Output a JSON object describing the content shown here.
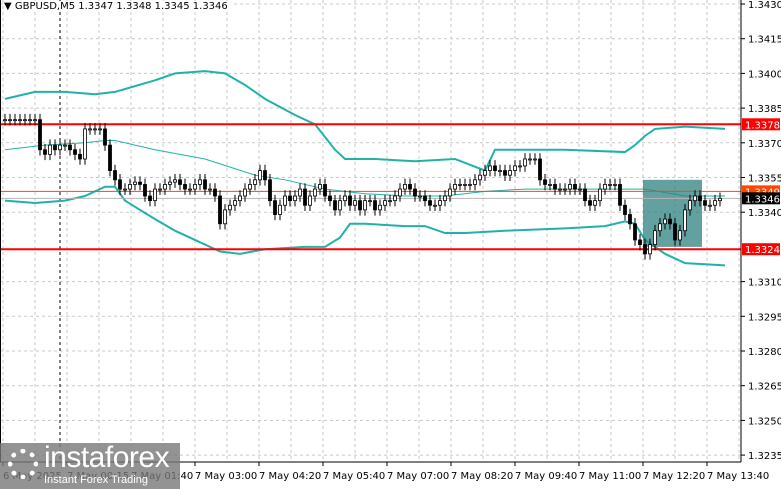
{
  "header": {
    "symbol": "GBPUSD,M5",
    "ohlc": "1.3347 1.3348 1.3345 1.3346"
  },
  "logo": {
    "brand": "instaforex",
    "tagline": "Instant Forex Trading"
  },
  "colors": {
    "band": "#20b2aa",
    "level": "#ff0000",
    "bid": "#ff4500",
    "highlight": "#2f8080"
  },
  "chart_data": {
    "type": "candlestick",
    "title": "GBPUSD,M5",
    "ylim": [
      1.3228,
      1.3432
    ],
    "yticks": [
      "1.3430",
      "1.3415",
      "1.3400",
      "1.3385",
      "1.3370",
      "1.3355",
      "1.3340",
      "1.3310",
      "1.3295",
      "1.3280",
      "1.3265",
      "1.3250",
      "1.3235"
    ],
    "xticks": [
      "6 May 2025",
      "7 May 00:15",
      "7 May 01:40",
      "7 May 03:00",
      "7 May 04:20",
      "7 May 05:40",
      "7 May 07:00",
      "7 May 08:20",
      "7 May 09:40",
      "7 May 11:00",
      "7 May 12:20",
      "7 May 13:40"
    ],
    "levels": [
      {
        "price": 1.3378,
        "label": "1.3378"
      },
      {
        "price": 1.3324,
        "label": "1.3324"
      }
    ],
    "ask_line": {
      "price": 1.3349,
      "label": "1.3349"
    },
    "bid_line": {
      "price": 1.3346,
      "label": "1.3346"
    },
    "highlight_zone": {
      "from_index": 128,
      "to_index": 139,
      "high": 1.3354,
      "low": 1.3325
    },
    "closes": [
      1.338,
      1.338,
      1.338,
      1.338,
      1.338,
      1.338,
      1.338,
      1.3367,
      1.3365,
      1.3369,
      1.3367,
      1.3369,
      1.3369,
      1.3367,
      1.3365,
      1.3363,
      1.3376,
      1.3376,
      1.3376,
      1.3376,
      1.3369,
      1.3358,
      1.3354,
      1.335,
      1.335,
      1.3352,
      1.3353,
      1.3352,
      1.3347,
      1.3345,
      1.335,
      1.335,
      1.3352,
      1.3353,
      1.3354,
      1.3352,
      1.335,
      1.335,
      1.3352,
      1.3354,
      1.335,
      1.335,
      1.3347,
      1.3335,
      1.3341,
      1.3343,
      1.3345,
      1.3347,
      1.335,
      1.3352,
      1.3354,
      1.3358,
      1.3354,
      1.3345,
      1.3339,
      1.3343,
      1.3347,
      1.3345,
      1.3347,
      1.335,
      1.3343,
      1.3347,
      1.335,
      1.3352,
      1.3347,
      1.3345,
      1.3341,
      1.3345,
      1.3347,
      1.3343,
      1.3345,
      1.3341,
      1.3345,
      1.3345,
      1.3341,
      1.3343,
      1.3345,
      1.3345,
      1.3347,
      1.335,
      1.3352,
      1.335,
      1.3347,
      1.3347,
      1.3345,
      1.3343,
      1.3343,
      1.3345,
      1.3347,
      1.335,
      1.3352,
      1.3352,
      1.3352,
      1.3352,
      1.3354,
      1.3356,
      1.3358,
      1.336,
      1.3358,
      1.3358,
      1.3356,
      1.3358,
      1.336,
      1.336,
      1.3363,
      1.3363,
      1.3363,
      1.3354,
      1.3352,
      1.3352,
      1.335,
      1.335,
      1.335,
      1.3352,
      1.335,
      1.335,
      1.3345,
      1.3343,
      1.3345,
      1.335,
      1.3352,
      1.3352,
      1.3352,
      1.3343,
      1.3339,
      1.3335,
      1.3328,
      1.3326,
      1.3322,
      1.3326,
      1.3332,
      1.3335,
      1.3337,
      1.3335,
      1.3328,
      1.3332,
      1.3341,
      1.3345,
      1.3347,
      1.3345,
      1.3343,
      1.3343,
      1.3345,
      1.3346
    ],
    "bands": {
      "upper": [
        [
          0,
          1.3389
        ],
        [
          6,
          1.3392
        ],
        [
          12,
          1.3392
        ],
        [
          18,
          1.3391
        ],
        [
          22,
          1.3392
        ],
        [
          30,
          1.3397
        ],
        [
          34,
          1.34
        ],
        [
          40,
          1.3401
        ],
        [
          44,
          1.34
        ],
        [
          48,
          1.3395
        ],
        [
          52,
          1.3389
        ],
        [
          58,
          1.3382
        ],
        [
          62,
          1.3378
        ],
        [
          66,
          1.3367
        ],
        [
          68,
          1.3363
        ],
        [
          74,
          1.3363
        ],
        [
          82,
          1.3362
        ],
        [
          90,
          1.3363
        ],
        [
          96,
          1.3358
        ],
        [
          98,
          1.3367
        ],
        [
          112,
          1.3367
        ],
        [
          124,
          1.3366
        ],
        [
          126,
          1.3369
        ],
        [
          128,
          1.3373
        ],
        [
          130,
          1.3376
        ],
        [
          136,
          1.3377
        ],
        [
          144,
          1.3376
        ]
      ],
      "middle": [
        [
          0,
          1.3367
        ],
        [
          8,
          1.3369
        ],
        [
          16,
          1.337
        ],
        [
          20,
          1.3371
        ],
        [
          22,
          1.3371
        ],
        [
          30,
          1.3367
        ],
        [
          40,
          1.3363
        ],
        [
          50,
          1.3356
        ],
        [
          56,
          1.3354
        ],
        [
          64,
          1.335
        ],
        [
          72,
          1.3348
        ],
        [
          80,
          1.3347
        ],
        [
          88,
          1.3347
        ],
        [
          96,
          1.3349
        ],
        [
          104,
          1.335
        ],
        [
          112,
          1.335
        ],
        [
          120,
          1.335
        ],
        [
          128,
          1.335
        ],
        [
          136,
          1.3347
        ],
        [
          144,
          1.3347
        ]
      ],
      "lower": [
        [
          0,
          1.3345
        ],
        [
          6,
          1.3344
        ],
        [
          12,
          1.3345
        ],
        [
          16,
          1.3347
        ],
        [
          20,
          1.3351
        ],
        [
          22,
          1.3351
        ],
        [
          24,
          1.3345
        ],
        [
          30,
          1.3337
        ],
        [
          34,
          1.3332
        ],
        [
          40,
          1.3326
        ],
        [
          43,
          1.3323
        ],
        [
          47,
          1.3322
        ],
        [
          52,
          1.3324
        ],
        [
          60,
          1.3325
        ],
        [
          64,
          1.3325
        ],
        [
          67,
          1.3329
        ],
        [
          69,
          1.3335
        ],
        [
          72,
          1.3335
        ],
        [
          80,
          1.3334
        ],
        [
          84,
          1.3334
        ],
        [
          88,
          1.3331
        ],
        [
          92,
          1.3331
        ],
        [
          100,
          1.3332
        ],
        [
          112,
          1.3333
        ],
        [
          120,
          1.3334
        ],
        [
          124,
          1.3336
        ],
        [
          126,
          1.3335
        ],
        [
          128,
          1.3328
        ],
        [
          132,
          1.3322
        ],
        [
          136,
          1.3318
        ],
        [
          144,
          1.3317
        ]
      ]
    }
  }
}
